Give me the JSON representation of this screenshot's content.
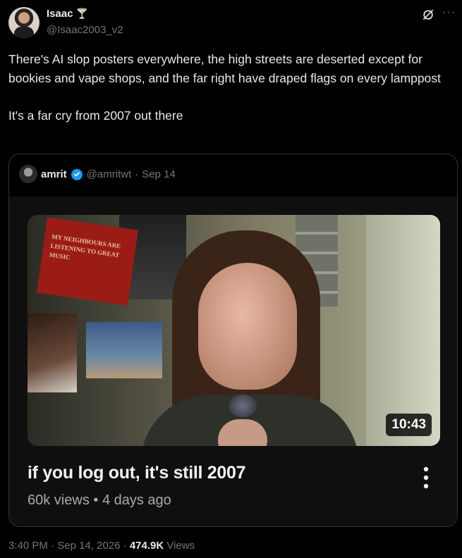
{
  "tweet": {
    "author": {
      "display_name": "Isaac",
      "name_emoji": "🍸",
      "handle": "@Isaac2003_v2"
    },
    "text": "There's AI slop posters everywhere, the high streets are deserted except for bookies and vape shops, and the far right have draped flags on every lamppost\n\nIt's a far cry from 2007 out there",
    "icons": {
      "grok": "grok-icon",
      "more": "more-icon"
    },
    "more_glyph": "···"
  },
  "quoted": {
    "display_name": "amrit",
    "handle": "@amritwt",
    "separator": "·",
    "date": "Sep 14",
    "verified_color": "#1d9bf0",
    "video": {
      "poster_text": "MY NEIGHBOURS ARE LISTENING TO GREAT MUSIC",
      "duration": "10:43",
      "title": "if you log out, it's still 2007",
      "views": "60k views",
      "meta_sep": "•",
      "age": "4 days ago"
    }
  },
  "footer": {
    "time": "3:40 PM",
    "sep1": "·",
    "date": "Sep 14, 2026",
    "sep2": "·",
    "views_count": "474.9K",
    "views_label": "Views"
  }
}
